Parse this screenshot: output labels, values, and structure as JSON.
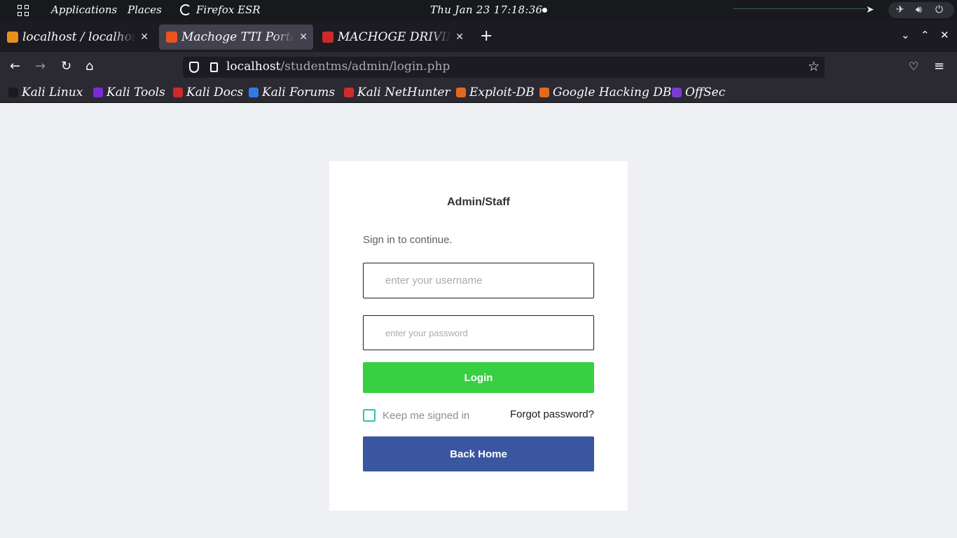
{
  "system_panel": {
    "applications": "Applications",
    "places": "Places",
    "active_app": "Firefox ESR",
    "clock": "Thu Jan 23  17:18:36"
  },
  "tabs": [
    {
      "title": "localhost / localhost",
      "active": false,
      "favicon_color": "#e98f1f"
    },
    {
      "title": "Machoge TTI Portal",
      "active": true,
      "favicon_color": "#e8541f"
    },
    {
      "title": "MACHOGE DRIVING",
      "active": false,
      "favicon_color": "#cc2a2a"
    }
  ],
  "toolbar": {
    "url_host": "localhost",
    "url_path": "/studentms/admin/login.php"
  },
  "bookmarks": [
    {
      "label": "Kali Linux",
      "icon_color": "#1a1a1a"
    },
    {
      "label": "Kali Tools",
      "icon_color": "#7a2bd6"
    },
    {
      "label": "Kali Docs",
      "icon_color": "#d02929"
    },
    {
      "label": "Kali Forums",
      "icon_color": "#2f7be6"
    },
    {
      "label": "Kali NetHunter",
      "icon_color": "#d12c2c"
    },
    {
      "label": "Exploit-DB",
      "icon_color": "#e36a1d"
    },
    {
      "label": "Google Hacking DB",
      "icon_color": "#e36a1d"
    },
    {
      "label": "OffSec",
      "icon_color": "#7a3bd1"
    }
  ],
  "login": {
    "title": "Admin/Staff",
    "subtitle": "Sign in to continue.",
    "username_placeholder": "enter your username",
    "password_placeholder": "enter your password",
    "login_label": "Login",
    "remember_label": "Keep me signed in",
    "remember_checked": false,
    "forgot_label": "Forgot password?",
    "back_label": "Back Home"
  },
  "colors": {
    "login_button": "#39cf43",
    "back_button": "#3b56a0",
    "checkbox_border": "#31c3b6",
    "page_background": "#eef0f4"
  }
}
